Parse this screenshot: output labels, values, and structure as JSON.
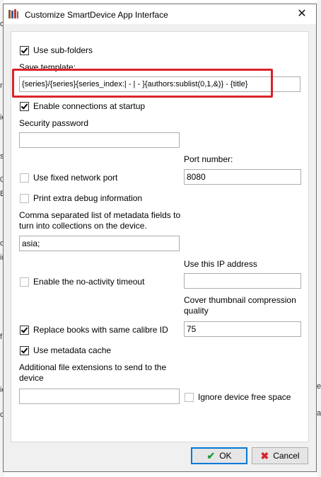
{
  "window": {
    "title": "Customize SmartDevice App Interface",
    "close_glyph": "✕",
    "icon": "calibre-books-icon"
  },
  "background_fragments": {
    "left": [
      "o",
      "r",
      "ic",
      "s",
      "0",
      "B",
      "ov",
      "ir",
      "f",
      "ie",
      "d"
    ],
    "right": [
      "er",
      "ac"
    ]
  },
  "settings": {
    "use_subfolders": {
      "label": "Use sub-folders",
      "checked": true
    },
    "save_template": {
      "label": "Save template:",
      "value": "{series}/{series}{series_index:| - | - }{authors:sublist(0,1,&)} - {title}"
    },
    "enable_connections": {
      "label": "Enable connections at startup",
      "checked": true
    },
    "security_password": {
      "label": "Security password",
      "value": ""
    },
    "port_number": {
      "label": "Port number:",
      "value": "8080"
    },
    "fixed_port": {
      "label": "Use fixed network port",
      "checked": false
    },
    "debug_info": {
      "label": "Print extra debug information",
      "checked": false
    },
    "metadata_collections": {
      "label": "Comma separated list of metadata fields to turn into collections on the device.",
      "value": "asia;"
    },
    "ip_address": {
      "label": "Use this IP address",
      "value": ""
    },
    "no_activity_timeout": {
      "label": "Enable the no-activity timeout",
      "checked": false
    },
    "thumbnail_quality": {
      "label": "Cover thumbnail compression quality",
      "value": "75"
    },
    "replace_books": {
      "label": "Replace books with same calibre ID",
      "checked": true
    },
    "metadata_cache": {
      "label": "Use metadata cache",
      "checked": true
    },
    "file_extensions": {
      "label": "Additional file extensions to send to the device",
      "value": ""
    },
    "ignore_free_space": {
      "label": "Ignore device free space",
      "checked": false
    }
  },
  "buttons": {
    "ok": {
      "label": "OK",
      "icon": "checkmark-icon"
    },
    "cancel": {
      "label": "Cancel",
      "icon": "x-icon"
    }
  },
  "colors": {
    "highlight": "#d9232b",
    "ok_icon": "#1e9b3a",
    "cancel_icon": "#d9232b",
    "focus_border": "#0078d7"
  }
}
